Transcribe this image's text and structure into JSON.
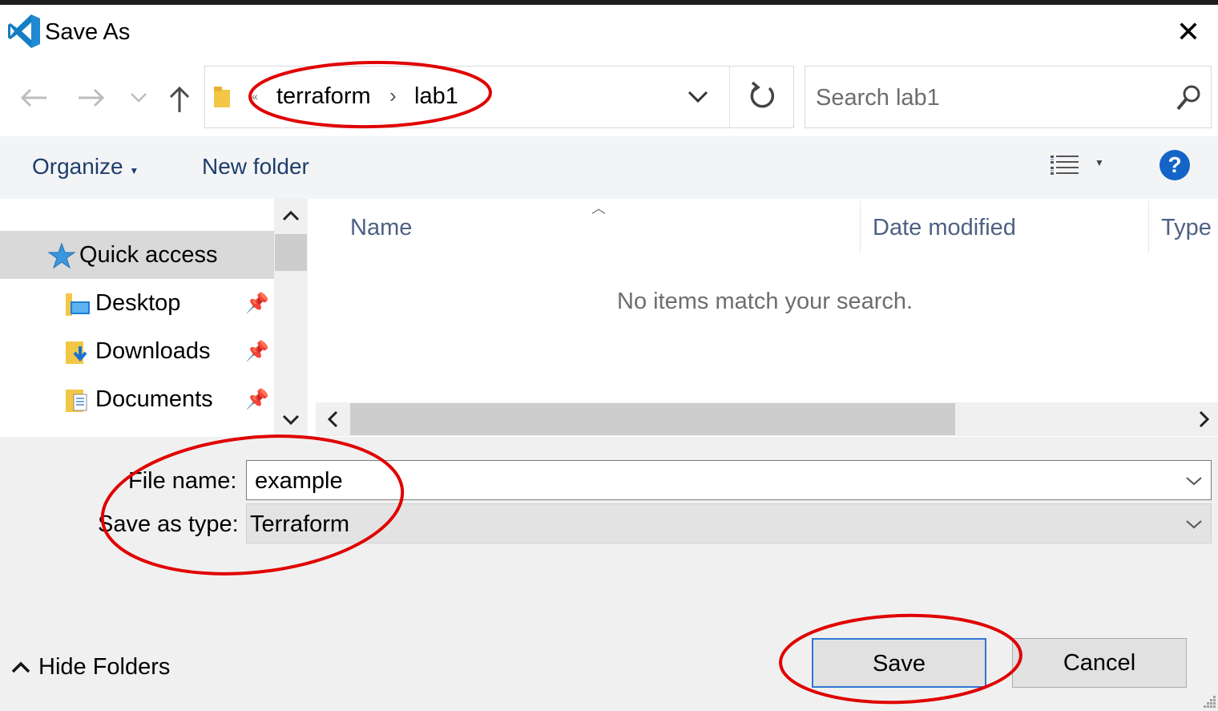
{
  "window": {
    "title": "Save As",
    "app_icon": "vscode-icon",
    "close_glyph": "✕"
  },
  "nav": {
    "back_icon": "arrow-left-icon",
    "forward_icon": "arrow-right-icon",
    "recent_icon": "chevron-down-icon",
    "up_icon": "arrow-up-icon"
  },
  "address": {
    "overflow_glyph": "«",
    "crumbs": [
      "terraform",
      "lab1"
    ],
    "separator": "›"
  },
  "search": {
    "placeholder": "Search lab1"
  },
  "toolbar": {
    "organize": "Organize",
    "new_folder": "New folder",
    "help": "?"
  },
  "sidebar": {
    "items": [
      {
        "label": "Quick access",
        "icon": "star-icon",
        "selected": true,
        "pinned": false
      },
      {
        "label": "Desktop",
        "icon": "desktop-folder-icon",
        "pinned": true
      },
      {
        "label": "Downloads",
        "icon": "downloads-folder-icon",
        "pinned": true
      },
      {
        "label": "Documents",
        "icon": "documents-folder-icon",
        "pinned": true
      }
    ]
  },
  "filelist": {
    "columns": [
      "Name",
      "Date modified",
      "Type"
    ],
    "empty_message": "No items match your search."
  },
  "form": {
    "filename_label": "File name:",
    "filename_value": "example",
    "type_label": "Save as type:",
    "type_value": "Terraform"
  },
  "footer": {
    "hide_folders": "Hide Folders",
    "save": "Save",
    "cancel": "Cancel"
  },
  "colors": {
    "accent_blue": "#1464c8",
    "link_text": "#1e3d6b",
    "annotation_red": "#e00000"
  }
}
